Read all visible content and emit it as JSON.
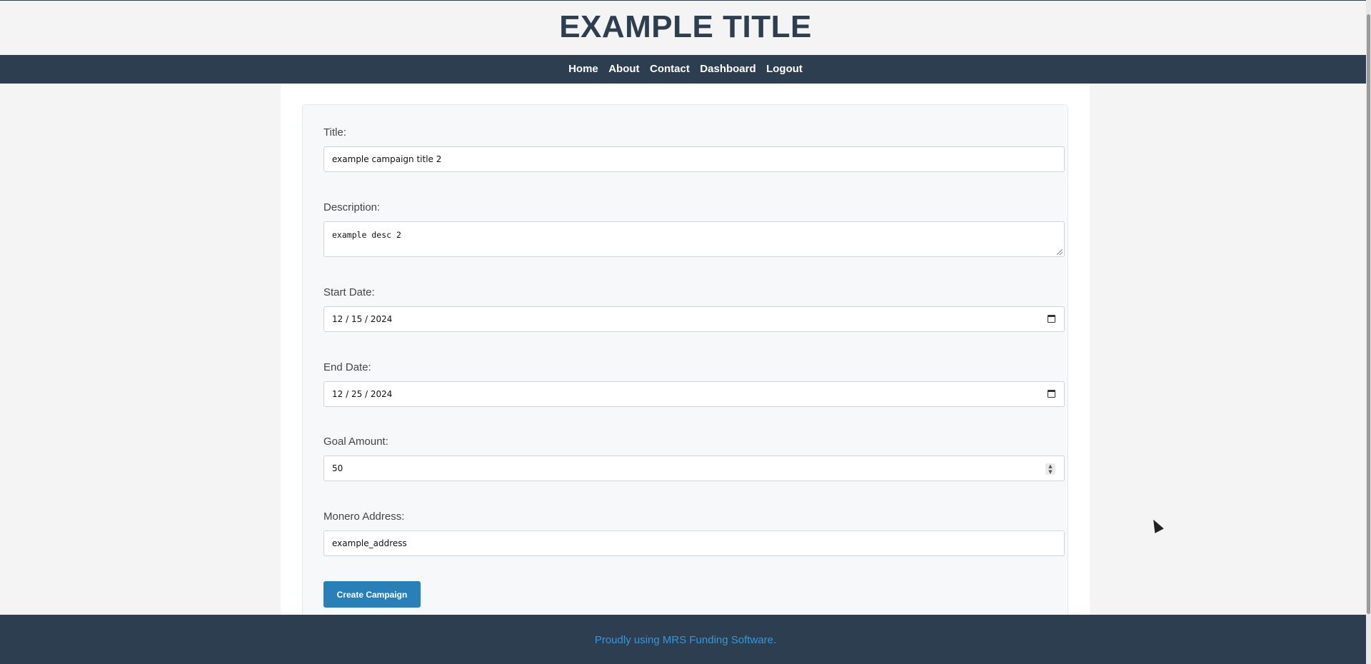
{
  "header": {
    "title": "EXAMPLE TITLE"
  },
  "nav": {
    "items": [
      {
        "label": "Home"
      },
      {
        "label": "About"
      },
      {
        "label": "Contact"
      },
      {
        "label": "Dashboard"
      },
      {
        "label": "Logout"
      }
    ]
  },
  "form": {
    "title": {
      "label": "Title:",
      "value": "example campaign title 2"
    },
    "description": {
      "label": "Description:",
      "value": "example desc 2"
    },
    "start_date": {
      "label": "Start Date:",
      "value": "12 / 15 / 2024",
      "icon": "calendar-icon"
    },
    "end_date": {
      "label": "End Date:",
      "value": "12 / 25 / 2024",
      "icon": "calendar-icon"
    },
    "goal_amount": {
      "label": "Goal Amount:",
      "value": "50"
    },
    "monero_address": {
      "label": "Monero Address:",
      "value": "example_address"
    },
    "submit_label": "Create Campaign"
  },
  "footer": {
    "text": "Proudly using MRS Funding Software."
  },
  "colors": {
    "brand_dark": "#2c3e50",
    "button": "#2980b9",
    "footer_link": "#3498db"
  }
}
